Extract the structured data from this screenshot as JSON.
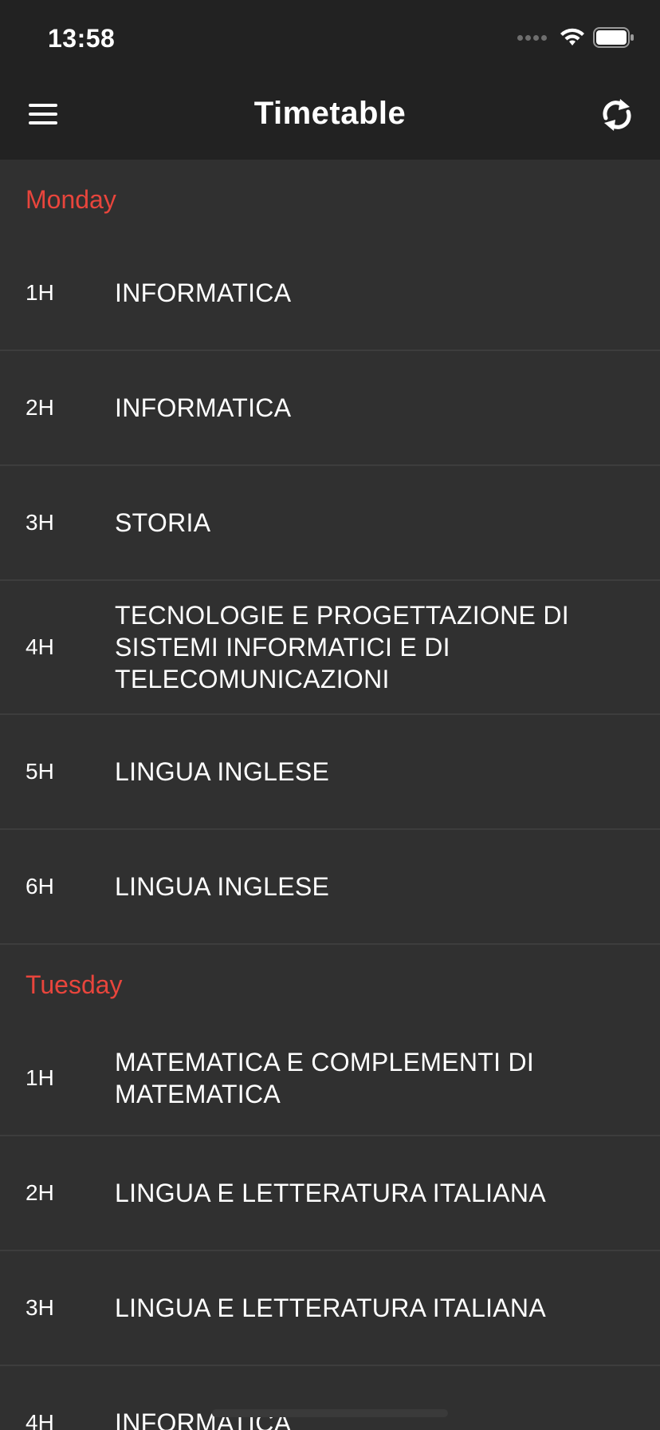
{
  "status_bar": {
    "time": "13:58"
  },
  "nav": {
    "title": "Timetable",
    "menu_icon": "hamburger-menu-icon",
    "refresh_icon": "refresh-icon"
  },
  "colors": {
    "accent": "#e8453c",
    "background": "#303030",
    "bar": "#222222",
    "divider": "#3d3d3d"
  },
  "days": [
    {
      "name": "Monday",
      "lessons": [
        {
          "hour": "1H",
          "subject": "INFORMATICA"
        },
        {
          "hour": "2H",
          "subject": "INFORMATICA"
        },
        {
          "hour": "3H",
          "subject": "STORIA"
        },
        {
          "hour": "4H",
          "subject": "TECNOLOGIE E PROGETTAZIONE DI SISTEMI INFORMATICI E DI TELECOMUNICAZIONI"
        },
        {
          "hour": "5H",
          "subject": "LINGUA INGLESE"
        },
        {
          "hour": "6H",
          "subject": "LINGUA INGLESE"
        }
      ]
    },
    {
      "name": "Tuesday",
      "lessons": [
        {
          "hour": "1H",
          "subject": "MATEMATICA E COMPLEMENTI DI MATEMATICA"
        },
        {
          "hour": "2H",
          "subject": "LINGUA E LETTERATURA ITALIANA"
        },
        {
          "hour": "3H",
          "subject": "LINGUA E LETTERATURA ITALIANA"
        },
        {
          "hour": "4H",
          "subject": "INFORMATICA"
        }
      ]
    }
  ]
}
